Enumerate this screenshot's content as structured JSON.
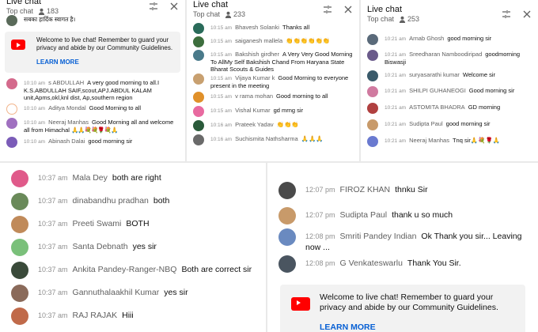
{
  "colors": {
    "accent": "#065fd4",
    "youtube_red": "#ff0000",
    "welcome_bg": "#f2f2f2"
  },
  "icons": {
    "viewers": "person-icon",
    "filter": "tune-icon",
    "close": "close-icon",
    "logo": "youtube-icon"
  },
  "panel1": {
    "title": "Live chat",
    "subtitle": "Top chat",
    "viewers": "183",
    "top_message": "सबका हार्दिक स्वागत है।",
    "welcome": {
      "text": "Welcome to live chat! Remember to guard your privacy and abide by our Community Guidelines.",
      "learn_more": "LEARN MORE"
    },
    "messages": [
      {
        "time": "10:10 am",
        "author": "s ABDULLAH",
        "text": "A very good morning to all.I K.S.ABDULLAH SAIF,scout,APJ.ABDUL KALAM unit,Apms,okl,knl dist, Ap,southern region",
        "color": "#d46a8c"
      },
      {
        "time": "10:10 am",
        "author": "Aditya Mondal",
        "text": "Good Morning to all",
        "color": "#f2b48a"
      },
      {
        "time": "10:10 am",
        "author": "Neeraj Manhas",
        "text": "Good Morning all and welcome all from Himachal",
        "color": "#a070c0"
      },
      {
        "time": "10:10 am",
        "author": "Abinash Dalai",
        "text": "good morning sir",
        "color": "#7b5cb8"
      }
    ],
    "emoji_text": "🙏🙏💐💐🌹💐🙏"
  },
  "panel2": {
    "title": "Live chat",
    "subtitle": "Top chat",
    "viewers": "233",
    "messages": [
      {
        "time": "10:15 am",
        "author": "Bhavesh Solanki",
        "text": "Thanks all",
        "color": "#2a6b5a"
      },
      {
        "time": "10:15 am",
        "author": "saiganesh mallela",
        "text": "👏👏👏👏👏👏",
        "color": "#3d6e3d"
      },
      {
        "time": "10:15 am",
        "author": "Bakshish girdher",
        "text": "A Very Very Good Morning To AllMy Self Bakshish Chand From Haryana State Bharat Scouts & Guides",
        "color": "#4a7a8a"
      },
      {
        "time": "10:15 am",
        "author": "Vijaya Kumar k",
        "text": "Good Morning to everyone present in the meeting",
        "color": "#c8a070"
      },
      {
        "time": "10:15 am",
        "author": "v rama mohan",
        "text": "Good morning to all",
        "color": "#e0902a"
      },
      {
        "time": "10:15 am",
        "author": "Vishal Kumar",
        "text": "gd mrng sir",
        "color": "#e86aa0"
      },
      {
        "time": "10:16 am",
        "author": "Prateek Yadav",
        "text": "👏👏👏",
        "color": "#2a5a3a"
      },
      {
        "time": "10:16 am",
        "author": "Suchismita Nathsharma",
        "text": "🙏🙏🙏",
        "color": "#6a6a6a"
      }
    ]
  },
  "panel3": {
    "title": "Live chat",
    "subtitle": "Top chat",
    "viewers": "253",
    "messages": [
      {
        "time": "10:21 am",
        "author": "Arnab Ghosh",
        "text": "good morning sir",
        "color": "#5a6a7a"
      },
      {
        "time": "10:21 am",
        "author": "Sreedharan Namboodiripad",
        "text": "goodmorning Biswasji",
        "color": "#6a5a8a"
      },
      {
        "time": "10:21 am",
        "author": "suryasarathi kumar",
        "text": "Welcome sir",
        "color": "#3a5a6a"
      },
      {
        "time": "10:21 am",
        "author": "SHILPI GUHANEOGI",
        "text": "Good morning sir",
        "color": "#d07aa0"
      },
      {
        "time": "10:21 am",
        "author": "ASTOMITA BHADRA",
        "text": "GD morning",
        "color": "#b04040"
      },
      {
        "time": "10:21 am",
        "author": "Sudipta Paul",
        "text": "good morning sir",
        "color": "#c89a6a"
      },
      {
        "time": "10:21 am",
        "author": "Neeraj Manhas",
        "text": "Tnq sir🙏💐🌹🙏",
        "color": "#6a7ad0"
      }
    ]
  },
  "panel4": {
    "messages": [
      {
        "time": "10:37 am",
        "author": "Mala Dey",
        "text": "both are right",
        "color": "#e05a8a"
      },
      {
        "time": "10:37 am",
        "author": "dinabandhu pradhan",
        "text": "both",
        "color": "#6a8a5a"
      },
      {
        "time": "10:37 am",
        "author": "Preeti Swami",
        "text": "BOTH",
        "color": "#c08a5a"
      },
      {
        "time": "10:37 am",
        "author": "Santa Debnath",
        "text": "yes sir",
        "color": "#7ac07a"
      },
      {
        "time": "10:37 am",
        "author": "Ankita Pandey-Ranger-NBQ",
        "text": "Both are correct sir",
        "color": "#3a4a3a"
      },
      {
        "time": "10:37 am",
        "author": "Gannuthalaakhil Kumar",
        "text": "yes sir",
        "color": "#8a6a5a"
      },
      {
        "time": "10:37 am",
        "author": "RAJ RAJAK",
        "text": "Hiii",
        "color": "#c06a4a"
      }
    ]
  },
  "panel5": {
    "messages": [
      {
        "time": "12:07 pm",
        "author": "FIROZ KHAN",
        "text": "thnku Sir",
        "color": "#4a4a4a"
      },
      {
        "time": "12:07 pm",
        "author": "Sudipta Paul",
        "text": "thank u so much",
        "color": "#c89a6a"
      },
      {
        "time": "12:08 pm",
        "author": "Smriti Pandey Indian",
        "text": "Ok Thank you sir... Leaving now ...",
        "color": "#6a8ac0"
      },
      {
        "time": "12:08 pm",
        "author": "G Venkateswarlu",
        "text": "Thank You Sir.",
        "color": "#4a5560"
      }
    ],
    "welcome": {
      "text": "Welcome to live chat! Remember to guard your privacy and abide by our Community Guidelines.",
      "learn_more": "LEARN MORE"
    }
  }
}
